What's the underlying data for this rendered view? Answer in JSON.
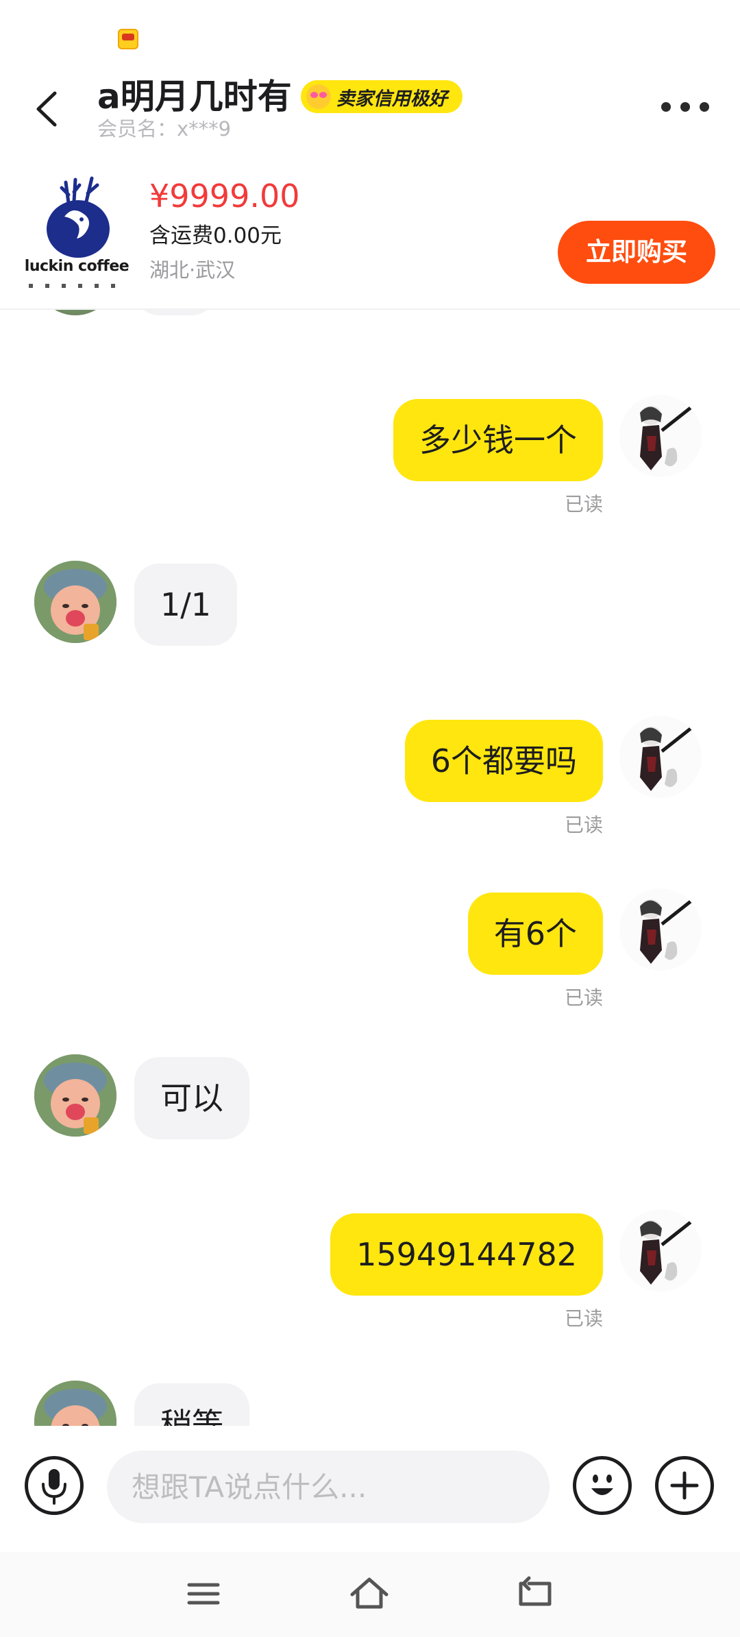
{
  "header": {
    "title": "a明月几时有",
    "credit_badge": "卖家信用极好",
    "member_name": "会员名：x***9"
  },
  "product": {
    "brand": "luckin coffee",
    "price": "¥9999.00",
    "shipping": "含运费0.00元",
    "location": "湖北·武汉",
    "buy_button": "立即购买"
  },
  "messages": [
    {
      "id": "m1",
      "side": "out",
      "text": "多少钱一个",
      "status": "已读"
    },
    {
      "id": "m2",
      "side": "in",
      "text": "1/1"
    },
    {
      "id": "m3",
      "side": "out",
      "text": "6个都要吗",
      "status": "已读"
    },
    {
      "id": "m4",
      "side": "out",
      "text": "有6个",
      "status": "已读"
    },
    {
      "id": "m5",
      "side": "in",
      "text": "可以"
    },
    {
      "id": "m6",
      "side": "out",
      "text": "15949144782",
      "status": "已读"
    },
    {
      "id": "m7",
      "side": "in",
      "text": "稍等"
    }
  ],
  "input": {
    "placeholder": "想跟TA说点什么..."
  },
  "colors": {
    "accent_yellow": "#ffe60f",
    "buy_button": "#ff4d0f",
    "price_red": "#f23a3a"
  },
  "icons": {
    "back": "chevron-left-icon",
    "more": "more-dots-icon",
    "voice": "microphone-icon",
    "emoji": "smiley-icon",
    "plus": "plus-icon",
    "nav_menu": "menu-lines-icon",
    "nav_home": "home-icon",
    "nav_back": "return-icon"
  }
}
